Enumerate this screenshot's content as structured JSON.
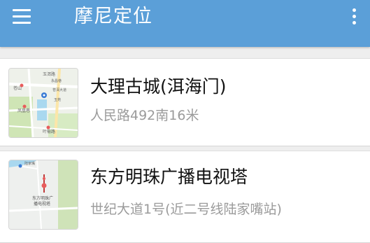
{
  "app": {
    "title": "摩尼定位",
    "bar_color": "#5b9fd8"
  },
  "icons": {
    "menu": "hamburger-menu-icon",
    "more": "more-vertical-icon"
  },
  "places": [
    {
      "name": "大理古城(洱海门)",
      "address": "人民路492南16米",
      "map_labels": [
        "玉洱路",
        "苍山",
        "凤凰巷",
        "永昌巷",
        "苍洱大道",
        "玉苑",
        "叶榆路"
      ]
    },
    {
      "name": "东方明珠广播电视塔",
      "address": "世纪大道1号(近二号线陆家嘴站)",
      "map_labels": [
        "东方明珠广",
        "播电视塔",
        "陆家嘴"
      ]
    }
  ]
}
